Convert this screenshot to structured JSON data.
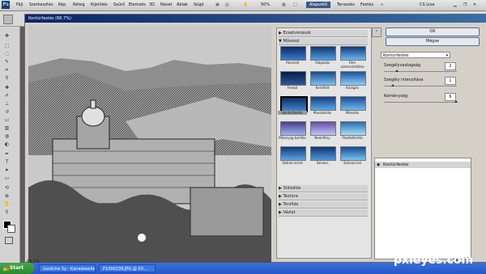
{
  "menubar": {
    "logo": "Ps",
    "items": [
      "Fájl",
      "Szerkesztés",
      "Kép",
      "Réteg",
      "Kijelölés",
      "Szűrő",
      "Elemzés",
      "3D",
      "Nézet",
      "Ablak",
      "Súgó"
    ],
    "zoom": "50%",
    "workspaces": [
      "Alapvető",
      "Tervezés",
      "Festés"
    ],
    "active_workspace": "Alapvető",
    "cs_live": "CS Live"
  },
  "window": {
    "title": "Kontúrfestés (66.7%)",
    "zoom": "66.7%"
  },
  "gallery": {
    "categories": [
      "Ecsetvonások",
      "Művészi",
      "Stilizálás",
      "Textúra",
      "Torzítás",
      "Vázlat"
    ],
    "filters": [
      "Akvarell",
      "Alapozás",
      "Film szemcsésítése",
      "Freskó",
      "Kenőfolt",
      "Kivágás",
      "Kontúrfestés",
      "Maszatolás",
      "Másolás",
      "Műanyag borítás",
      "Neonfény",
      "Pasztellkréta",
      "Száraz ecset",
      "Szivacs",
      "Szóvaccsal"
    ],
    "selected_filter": "Kontúrfestés"
  },
  "controls": {
    "ok_label": "OK",
    "cancel_label": "Mégse",
    "filter_select": "Kontúrfestés",
    "params": [
      {
        "label": "Szegélyvastagság",
        "value": "2"
      },
      {
        "label": "Szegély intenzitása",
        "value": "1"
      },
      {
        "label": "Keménység",
        "value": "6"
      }
    ],
    "effect_layer": "Kontúrfestés"
  },
  "taskbar": {
    "start_label": "Start",
    "tasks": [
      "Gesliche Sy - Kanadaseite",
      "P1000239.JPG @ 50..."
    ]
  },
  "watermark": "pxleyes.com"
}
